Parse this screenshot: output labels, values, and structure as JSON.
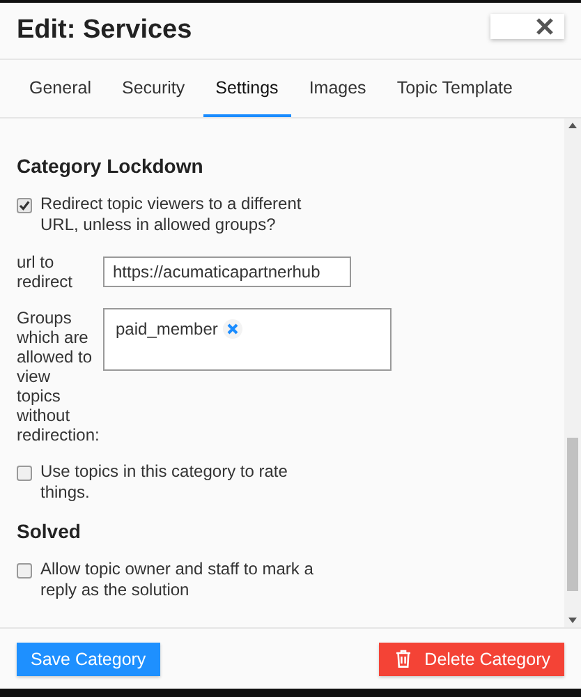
{
  "window": {
    "title": "Edit: Services"
  },
  "tabs": [
    {
      "label": "General",
      "selected": false
    },
    {
      "label": "Security",
      "selected": false
    },
    {
      "label": "Settings",
      "selected": true
    },
    {
      "label": "Images",
      "selected": false
    },
    {
      "label": "Topic Template",
      "selected": false
    }
  ],
  "settings": [
    {
      "kind": "heading",
      "text": "Category Lockdown"
    },
    {
      "kind": "checkbox",
      "label": "Redirect topic viewers to a different URL, unless in allowed groups?",
      "checked": true
    },
    {
      "kind": "text",
      "label": "url to redirect",
      "value": "https://acumaticapartnerhub"
    },
    {
      "kind": "tags",
      "label": "Groups which are allowed to view topics without redirection:",
      "tags": [
        "paid_member"
      ]
    },
    {
      "kind": "checkbox",
      "label": "Use topics in this category to rate things.",
      "checked": false
    },
    {
      "kind": "heading",
      "text": "Solved"
    },
    {
      "kind": "checkbox",
      "label": "Allow topic owner and staff to mark a reply as the solution",
      "checked": false
    }
  ],
  "footer": {
    "save": "Save Category",
    "delete": "Delete Category"
  }
}
